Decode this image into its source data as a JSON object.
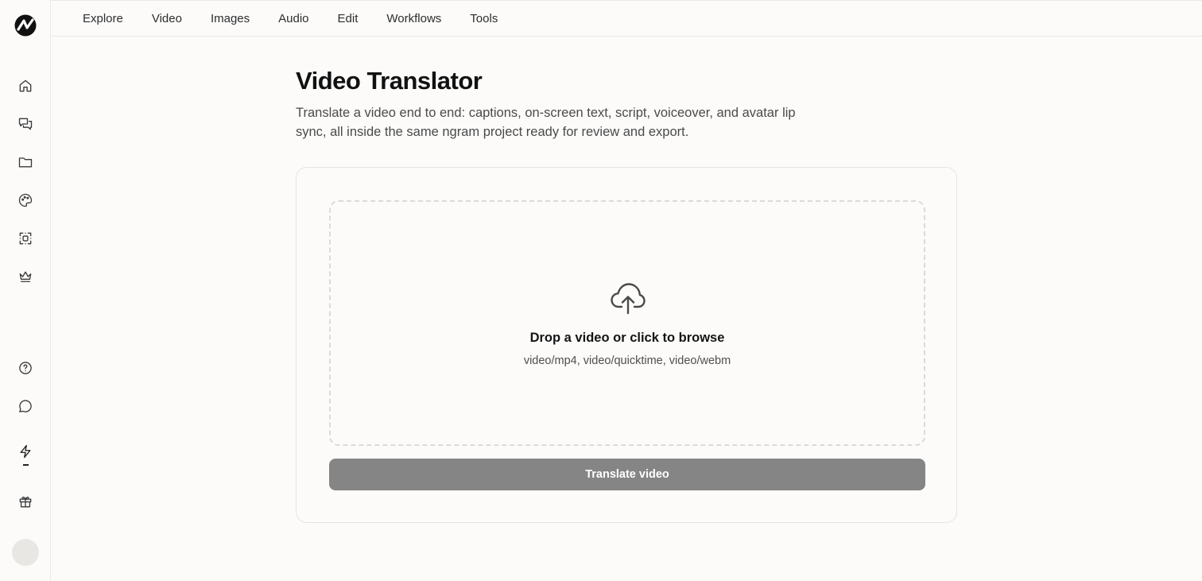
{
  "nav": {
    "items": [
      {
        "label": "Explore"
      },
      {
        "label": "Video"
      },
      {
        "label": "Images"
      },
      {
        "label": "Audio"
      },
      {
        "label": "Edit"
      },
      {
        "label": "Workflows"
      },
      {
        "label": "Tools"
      }
    ]
  },
  "sidebar": {
    "logo": "logo-icon",
    "icons": [
      "home-icon",
      "chat-icon",
      "folder-icon",
      "palette-icon",
      "scan-icon",
      "crown-icon",
      "help-icon",
      "message-icon",
      "bolt-icon",
      "gift-icon"
    ]
  },
  "page": {
    "title": "Video Translator",
    "description": "Translate a video end to end: captions, on-screen text, script, voiceover, and avatar lip sync, all inside the same ngram project ready for review and export."
  },
  "upload": {
    "title": "Drop a video or click to browse",
    "types": "video/mp4, video/quicktime, video/webm",
    "button_label": "Translate video"
  },
  "colors": {
    "background": "#fcfbfa",
    "button_disabled": "#858585",
    "border": "#e6e4e1"
  }
}
